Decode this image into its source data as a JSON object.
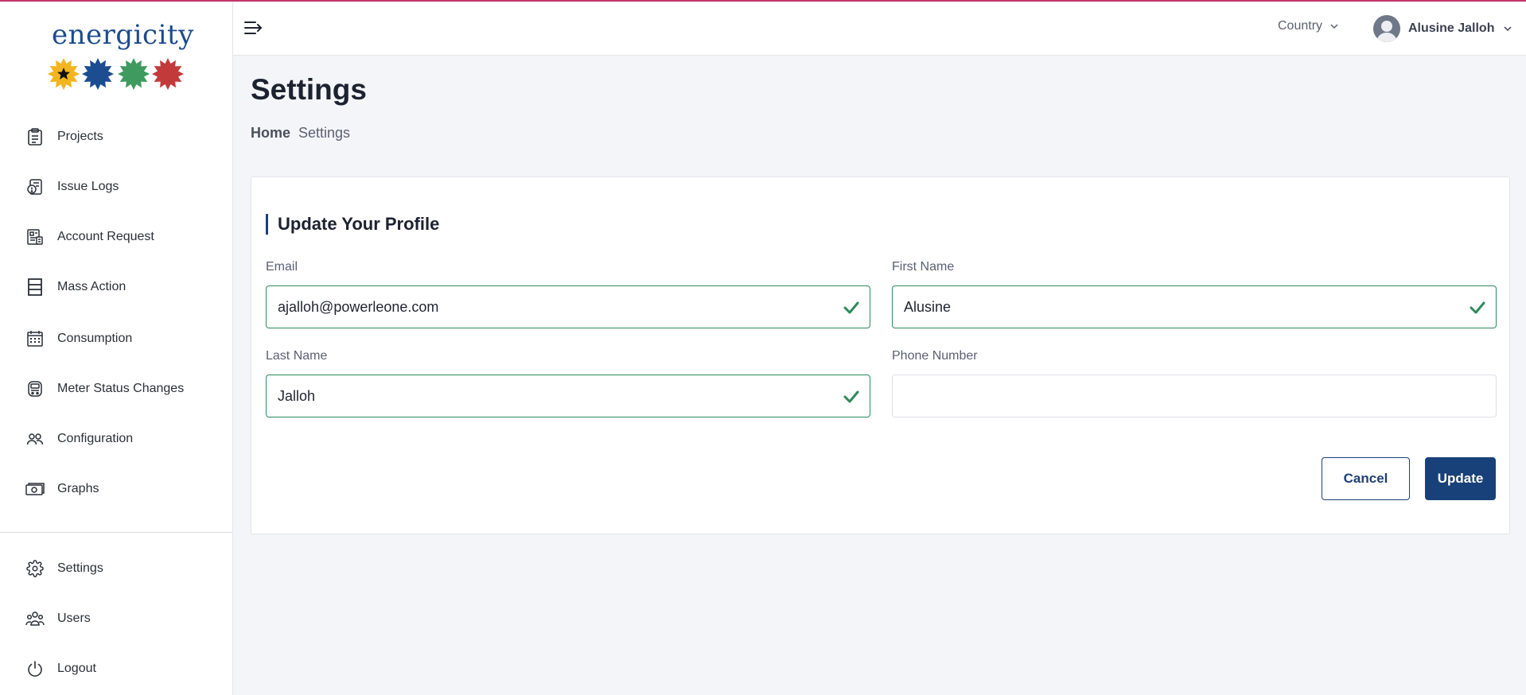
{
  "app": {
    "brand": "energicity",
    "accent_color": "#c9356a",
    "primary_color": "#174178",
    "success_color": "#2e8a5a"
  },
  "sidebar": {
    "items": [
      {
        "label": "Projects",
        "icon": "clipboard-list-icon"
      },
      {
        "label": "Issue Logs",
        "icon": "issue-log-icon"
      },
      {
        "label": "Account Request",
        "icon": "account-request-icon"
      },
      {
        "label": "Mass Action",
        "icon": "grid-rows-icon"
      },
      {
        "label": "Consumption",
        "icon": "calendar-icon"
      },
      {
        "label": "Meter Status Changes",
        "icon": "meter-icon"
      },
      {
        "label": "Configuration",
        "icon": "users-pair-icon"
      },
      {
        "label": "Graphs",
        "icon": "cash-icon"
      }
    ],
    "bottom_items": [
      {
        "label": "Settings",
        "icon": "gear-icon"
      },
      {
        "label": "Users",
        "icon": "users-group-icon"
      },
      {
        "label": "Logout",
        "icon": "power-icon"
      }
    ]
  },
  "header": {
    "country_label": "Country",
    "user_name": "Alusine Jalloh"
  },
  "page": {
    "title": "Settings",
    "breadcrumb": {
      "home": "Home",
      "current": "Settings"
    }
  },
  "form": {
    "title": "Update Your Profile",
    "email": {
      "label": "Email",
      "value": "ajalloh@powerleone.com",
      "placeholder": ""
    },
    "first_name": {
      "label": "First Name",
      "value": "Alusine",
      "placeholder": ""
    },
    "last_name": {
      "label": "Last Name",
      "value": "Jalloh",
      "placeholder": ""
    },
    "phone": {
      "label": "Phone Number",
      "value": "",
      "placeholder": ""
    },
    "cancel_label": "Cancel",
    "update_label": "Update"
  }
}
